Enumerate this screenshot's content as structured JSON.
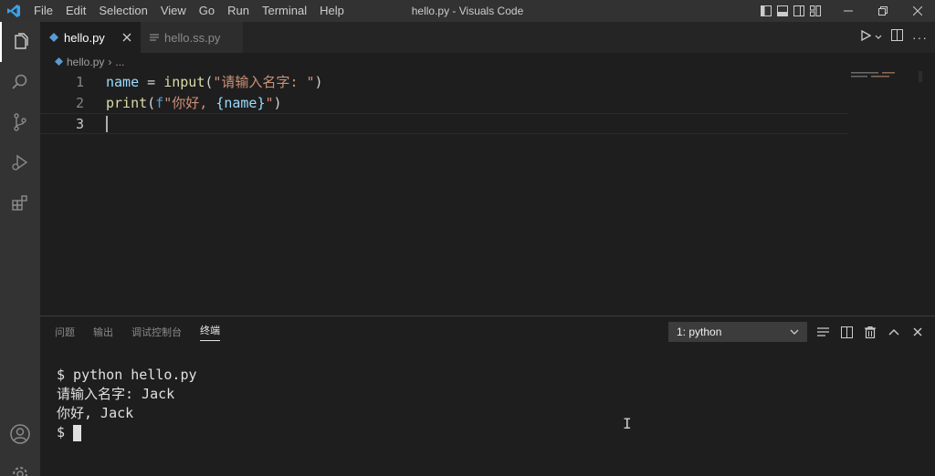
{
  "titlebar": {
    "menu": [
      "File",
      "Edit",
      "Selection",
      "View",
      "Go",
      "Run",
      "Terminal",
      "Help"
    ],
    "window_title": "hello.py - Visuals Code"
  },
  "tabs": [
    {
      "label": "hello.py",
      "active": true
    },
    {
      "label": "hello.ss.py",
      "active": false
    }
  ],
  "breadcrumb": {
    "file": "hello.py",
    "rest": "..."
  },
  "editor": {
    "line_numbers": [
      "1",
      "2",
      "3"
    ],
    "line1": {
      "var": "name",
      "op": " = ",
      "fn": "input",
      "open": "(",
      "str": "\"请输入名字: \"",
      "close": ")"
    },
    "line2": {
      "fn": "print",
      "open": "(",
      "prefix": "f",
      "str_a": "\"你好, ",
      "interp": "{name}",
      "str_b": "\"",
      "close": ")"
    }
  },
  "panel": {
    "tabs": [
      "问题",
      "输出",
      "调试控制台",
      "终端"
    ],
    "active_tab": "终端",
    "terminal_select": "1: python",
    "terminal_lines": [
      "$ python hello.py",
      "请输入名字: Jack",
      "你好, Jack"
    ],
    "prompt": "$"
  },
  "icons": {
    "activity": [
      "explorer-icon",
      "search-icon",
      "source-control-icon",
      "run-debug-icon",
      "extensions-icon",
      "account-icon",
      "settings-icon"
    ]
  },
  "colors": {
    "accent": "#007acc",
    "variable": "#9cdcfe",
    "function": "#dcdcaa",
    "string": "#ce9178"
  }
}
